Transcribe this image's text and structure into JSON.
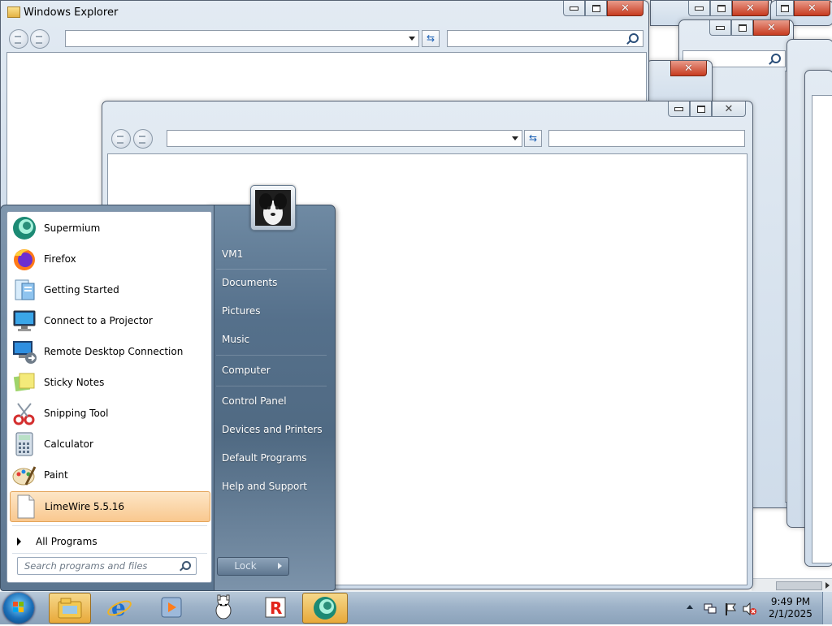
{
  "windows": {
    "main_title": "Windows Explorer"
  },
  "start_menu": {
    "programs": [
      {
        "label": "Supermium",
        "icon": "supermium-icon"
      },
      {
        "label": "Firefox",
        "icon": "firefox-icon"
      },
      {
        "label": "Getting Started",
        "icon": "getting-started-icon"
      },
      {
        "label": "Connect to a Projector",
        "icon": "projector-icon"
      },
      {
        "label": "Remote Desktop Connection",
        "icon": "remote-desktop-icon"
      },
      {
        "label": "Sticky Notes",
        "icon": "sticky-notes-icon"
      },
      {
        "label": "Snipping Tool",
        "icon": "snipping-tool-icon"
      },
      {
        "label": "Calculator",
        "icon": "calculator-icon"
      },
      {
        "label": "Paint",
        "icon": "paint-icon"
      },
      {
        "label": "LimeWire 5.5.16",
        "icon": "document-icon",
        "highlighted": true
      }
    ],
    "all_programs": "All Programs",
    "search_placeholder": "Search programs and files",
    "right_links": [
      "VM1",
      "Documents",
      "Pictures",
      "Music",
      "Computer",
      "Control Panel",
      "Devices and Printers",
      "Default Programs",
      "Help and Support"
    ],
    "lock_label": "Lock"
  },
  "taskbar": {
    "pinned": [
      "explorer-icon",
      "internet-explorer-icon",
      "media-player-icon",
      "alpaca-icon",
      "roblox-icon",
      "supermium-icon"
    ],
    "clock_time": "9:49 PM",
    "clock_date": "2/1/2025"
  }
}
